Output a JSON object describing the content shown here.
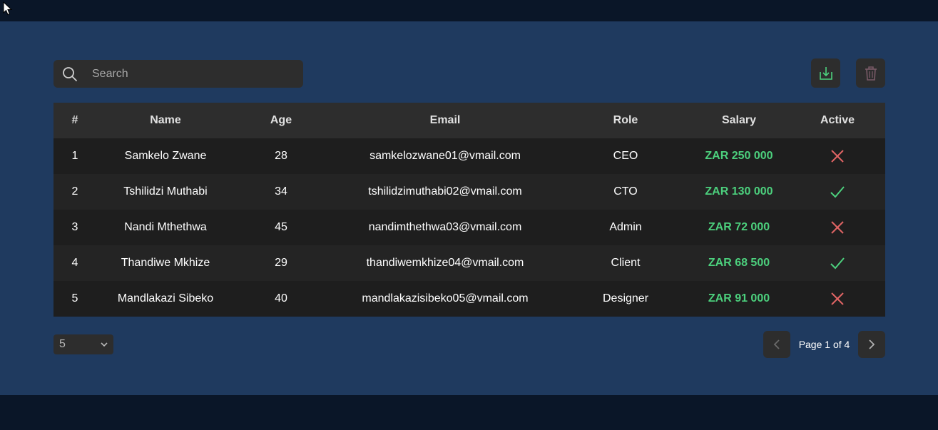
{
  "colors": {
    "outer_bg": "#0a1628",
    "panel_bg": "#1f3a5f",
    "control_bg": "#2d2d2d",
    "salary": "#4cd07d",
    "inactive": "#e06464",
    "active": "#4cd07d",
    "download_icon": "#4cd07d",
    "delete_icon": "#7a5b68"
  },
  "toolbar": {
    "search_placeholder": "Search",
    "search_value": "",
    "search_icon": "search-icon",
    "download_icon": "download-icon",
    "delete_icon": "trash-icon"
  },
  "table": {
    "columns": [
      "#",
      "Name",
      "Age",
      "Email",
      "Role",
      "Salary",
      "Active"
    ],
    "rows": [
      {
        "id": "1",
        "name": "Samkelo Zwane",
        "age": "28",
        "email": "samkelozwane01@vmail.com",
        "role": "CEO",
        "salary": "ZAR 250 000",
        "active": false
      },
      {
        "id": "2",
        "name": "Tshilidzi Muthabi",
        "age": "34",
        "email": "tshilidzimuthabi02@vmail.com",
        "role": "CTO",
        "salary": "ZAR 130 000",
        "active": true
      },
      {
        "id": "3",
        "name": "Nandi Mthethwa",
        "age": "45",
        "email": "nandimthethwa03@vmail.com",
        "role": "Admin",
        "salary": "ZAR 72 000",
        "active": false
      },
      {
        "id": "4",
        "name": "Thandiwe Mkhize",
        "age": "29",
        "email": "thandiwemkhize04@vmail.com",
        "role": "Client",
        "salary": "ZAR 68 500",
        "active": true
      },
      {
        "id": "5",
        "name": "Mandlakazi Sibeko",
        "age": "40",
        "email": "mandlakazisibeko05@vmail.com",
        "role": "Designer",
        "salary": "ZAR 91 000",
        "active": false
      }
    ]
  },
  "pagination": {
    "page_size": "5",
    "page_info": "Page 1 of 4",
    "prev_icon": "chevron-left-icon",
    "next_icon": "chevron-right-icon"
  }
}
